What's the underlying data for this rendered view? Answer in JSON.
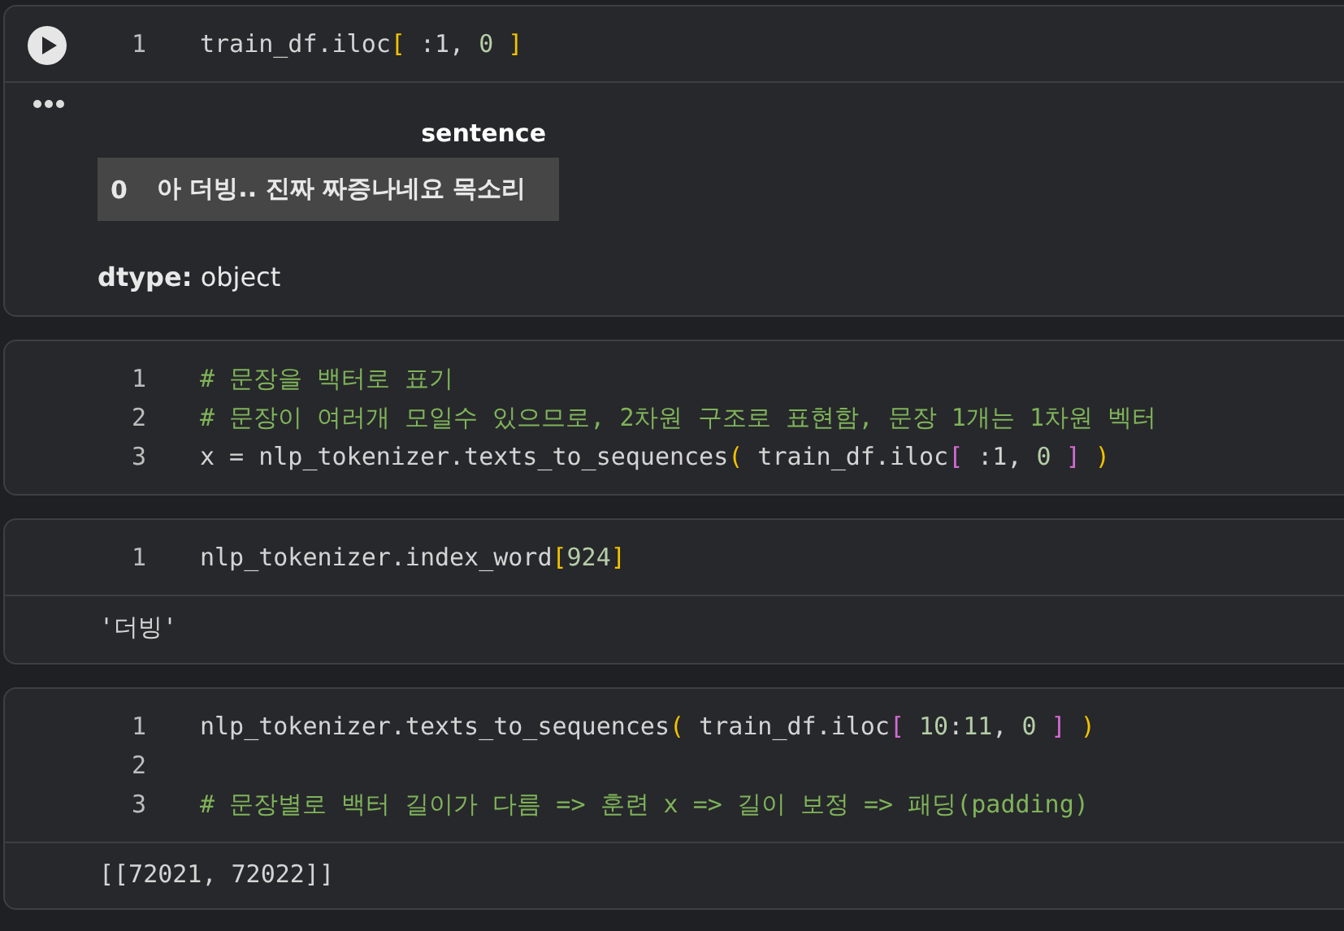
{
  "cells": [
    {
      "lines": [
        {
          "number": "1",
          "tokens": [
            {
              "kind": "plain",
              "text": "train_df.iloc"
            },
            {
              "kind": "bracket",
              "text": "["
            },
            {
              "kind": "plain",
              "text": " :1, "
            },
            {
              "kind": "number",
              "text": "0"
            },
            {
              "kind": "bracket",
              "text": " ]"
            }
          ]
        }
      ],
      "output": {
        "kind": "series",
        "header": "sentence",
        "rows": [
          {
            "index": "0",
            "value": "아 더빙.. 진짜 짜증나네요 목소리"
          }
        ],
        "dtype": "**dtype:** object"
      }
    },
    {
      "lines": [
        {
          "number": "1",
          "tokens": [
            {
              "kind": "comment",
              "text": "# 문장을 백터로 표기"
            }
          ]
        },
        {
          "number": "2",
          "tokens": [
            {
              "kind": "comment",
              "text": "# 문장이 여러개 모일수 있으므로, 2차원 구조로 표현함, 문장 1개는 1차원 벡터"
            }
          ]
        },
        {
          "number": "3",
          "tokens": [
            {
              "kind": "plain",
              "text": "x = nlp_tokenizer.texts_to_sequences"
            },
            {
              "kind": "bracket",
              "text": "("
            },
            {
              "kind": "plain",
              "text": " train_df.iloc"
            },
            {
              "kind": "bracket2",
              "text": "["
            },
            {
              "kind": "plain",
              "text": " :1, "
            },
            {
              "kind": "number",
              "text": "0"
            },
            {
              "kind": "bracket2",
              "text": " ]"
            },
            {
              "kind": "bracket",
              "text": " )"
            }
          ]
        }
      ]
    },
    {
      "lines": [
        {
          "number": "1",
          "tokens": [
            {
              "kind": "plain",
              "text": "nlp_tokenizer.index_word"
            },
            {
              "kind": "bracket",
              "text": "["
            },
            {
              "kind": "number",
              "text": "924"
            },
            {
              "kind": "bracket",
              "text": "]"
            }
          ]
        }
      ],
      "output": {
        "kind": "text",
        "text": "'더빙'"
      }
    },
    {
      "lines": [
        {
          "number": "1",
          "tokens": [
            {
              "kind": "plain",
              "text": "nlp_tokenizer.texts_to_sequences"
            },
            {
              "kind": "bracket",
              "text": "("
            },
            {
              "kind": "plain",
              "text": " train_df.iloc"
            },
            {
              "kind": "bracket2",
              "text": "["
            },
            {
              "kind": "number",
              "text": " 10"
            },
            {
              "kind": "plain",
              "text": ":"
            },
            {
              "kind": "number",
              "text": "11"
            },
            {
              "kind": "plain",
              "text": ", "
            },
            {
              "kind": "number",
              "text": "0"
            },
            {
              "kind": "bracket2",
              "text": " ]"
            },
            {
              "kind": "bracket",
              "text": " )"
            }
          ]
        },
        {
          "number": "2"
        },
        {
          "number": "3",
          "tokens": [
            {
              "kind": "comment",
              "text": "# 문장별로 백터 길이가 다름 => 훈련 x => 길이 보정 => 패딩(padding)"
            }
          ]
        }
      ],
      "output": {
        "kind": "text",
        "text": "[[72021, 72022]]"
      }
    }
  ]
}
